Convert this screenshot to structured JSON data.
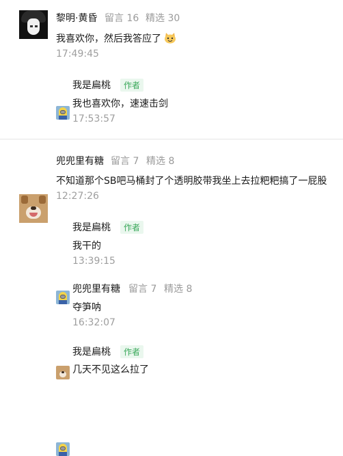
{
  "comments": [
    {
      "name": "黎明·黄昏",
      "replies_label": "留言 16",
      "featured_label": "精选 30",
      "content": "我喜欢你，然后我答应了",
      "time": "17:49:45",
      "reply": {
        "name": "我是扁桃",
        "badge": "作者",
        "content": "我也喜欢你，速速击剑",
        "time": "17:53:57"
      }
    },
    {
      "name": "兜兜里有糖",
      "replies_label": "留言 7",
      "featured_label": "精选 8",
      "content": "不知道那个SB吧马桶封了个透明胶带我坐上去拉粑粑搞了一屁股",
      "time": "12:27:26",
      "replies": [
        {
          "name": "我是扁桃",
          "badge": "作者",
          "content": "我干的",
          "time": "13:39:15"
        },
        {
          "name": "兜兜里有糖",
          "replies_label": "留言 7",
          "featured_label": "精选 8",
          "content": "夺笋呐",
          "time": "16:32:07"
        },
        {
          "name": "我是扁桃",
          "badge": "作者",
          "content": "几天不见这么拉了"
        }
      ]
    }
  ],
  "icons": {
    "emoji": "cat-face-emoji-icon"
  },
  "colors": {
    "badge_text": "#3aa85a",
    "badge_bg": "#eaf7ee",
    "meta": "#9a9a9a"
  }
}
